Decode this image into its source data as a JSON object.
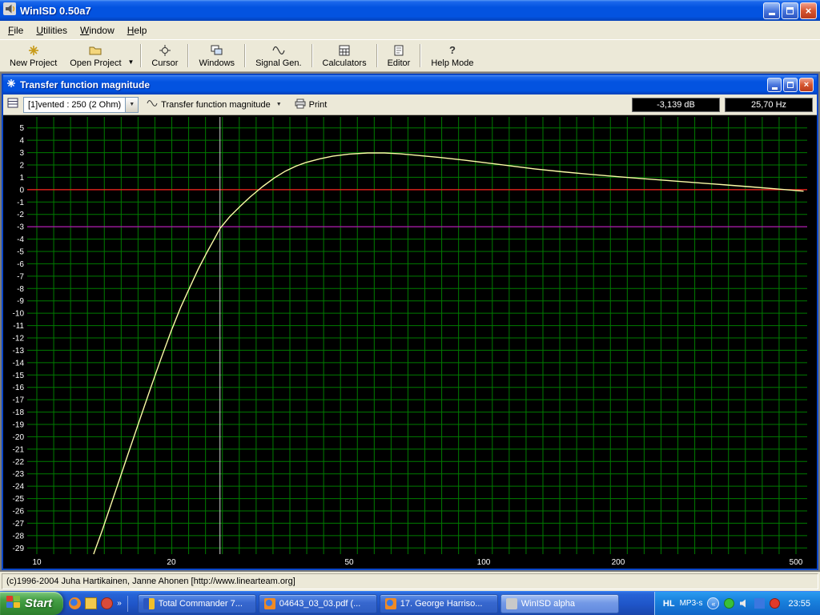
{
  "window": {
    "title": "WinISD 0.50a7",
    "menu": [
      {
        "label": "File"
      },
      {
        "label": "Utilities"
      },
      {
        "label": "Window"
      },
      {
        "label": "Help"
      }
    ]
  },
  "toolbar": {
    "buttons": [
      {
        "label": "New Project",
        "icon": "new-project-icon"
      },
      {
        "label": "Open Project",
        "icon": "open-project-icon"
      },
      {
        "label": "Cursor",
        "icon": "cursor-icon"
      },
      {
        "label": "Windows",
        "icon": "windows-icon"
      },
      {
        "label": "Signal Gen.",
        "icon": "signal-gen-icon"
      },
      {
        "label": "Calculators",
        "icon": "calculators-icon"
      },
      {
        "label": "Editor",
        "icon": "editor-icon"
      },
      {
        "label": "Help Mode",
        "icon": "help-mode-icon"
      }
    ]
  },
  "plot_window": {
    "title": "Transfer function magnitude",
    "project_selector": "[1]vented : 250 (2 Ohm)",
    "graph_selector": "Transfer function magnitude",
    "print_label": "Print"
  },
  "statusbar": {
    "text": "(c)1996-2004 Juha Hartikainen, Janne Ahonen [http://www.linearteam.org]"
  },
  "taskbar": {
    "start_label": "Start",
    "tasks": [
      {
        "label": "Total Commander 7...",
        "active": false,
        "icon": "total-commander-icon"
      },
      {
        "label": "04643_03_03.pdf (...",
        "active": false,
        "icon": "firefox-document-icon"
      },
      {
        "label": "17. George Harriso...",
        "active": false,
        "icon": "firefox-document-icon"
      },
      {
        "label": "WinISD alpha",
        "active": true,
        "icon": "winisd-icon"
      }
    ],
    "tray": {
      "lang": "HL",
      "item": "MP3-s",
      "clock": "23:55"
    }
  },
  "icons": {
    "dropdown": "▼",
    "double-left": "«",
    "double-right": "»",
    "question": "?",
    "close": "×"
  },
  "chart_data": {
    "type": "line",
    "title": "Transfer function magnitude",
    "x_axis": {
      "scale": "log",
      "unit": "Hz",
      "min": 10,
      "max": 500,
      "ticks": [
        10,
        20,
        50,
        100,
        200,
        500
      ]
    },
    "y_axis": {
      "unit": "dB",
      "min": -29,
      "max": 5,
      "step": 1,
      "ticks": [
        5,
        4,
        3,
        2,
        1,
        0,
        -1,
        -2,
        -3,
        -4,
        -5,
        -6,
        -7,
        -8,
        -9,
        -10,
        -11,
        -12,
        -13,
        -14,
        -15,
        -16,
        -17,
        -18,
        -19,
        -20,
        -21,
        -22,
        -23,
        -24,
        -25,
        -26,
        -27,
        -28,
        -29
      ]
    },
    "grid": {
      "color": "#007C00",
      "vertical_divisions": 45,
      "background": "#000000",
      "label_color": "#FFFFFF"
    },
    "reference_lines": [
      {
        "value": 0,
        "color": "#FF2020",
        "name": "zero-db-reference"
      },
      {
        "value": -3,
        "color": "#B318B3",
        "name": "minus-3db-reference"
      }
    ],
    "cursor": {
      "frequency_hz": 25.7,
      "color": "#D8D8D8",
      "readout_db": "-3,139 dB",
      "readout_hz": "25,70 Hz"
    },
    "series": [
      {
        "name": "[1]vented : 250 (2 Ohm)",
        "color": "#FBFBA6",
        "points": [
          [
            13.4,
            -29.5
          ],
          [
            14,
            -27.6
          ],
          [
            15,
            -24.4
          ],
          [
            16,
            -21.4
          ],
          [
            17,
            -18.6
          ],
          [
            18,
            -16.0
          ],
          [
            19,
            -13.6
          ],
          [
            20,
            -11.4
          ],
          [
            21,
            -9.5
          ],
          [
            22,
            -7.9
          ],
          [
            23,
            -6.4
          ],
          [
            24,
            -5.1
          ],
          [
            25,
            -3.95
          ],
          [
            25.7,
            -3.139
          ],
          [
            27,
            -2.2
          ],
          [
            28.5,
            -1.35
          ],
          [
            30,
            -0.6
          ],
          [
            32,
            0.25
          ],
          [
            34,
            0.95
          ],
          [
            36,
            1.5
          ],
          [
            38,
            1.9
          ],
          [
            40,
            2.2
          ],
          [
            43,
            2.5
          ],
          [
            46,
            2.72
          ],
          [
            50,
            2.88
          ],
          [
            55,
            2.97
          ],
          [
            60,
            2.97
          ],
          [
            65,
            2.9
          ],
          [
            70,
            2.8
          ],
          [
            80,
            2.6
          ],
          [
            90,
            2.4
          ],
          [
            100,
            2.2
          ],
          [
            115,
            1.92
          ],
          [
            130,
            1.68
          ],
          [
            150,
            1.45
          ],
          [
            170,
            1.27
          ],
          [
            200,
            1.05
          ],
          [
            230,
            0.88
          ],
          [
            260,
            0.73
          ],
          [
            300,
            0.56
          ],
          [
            350,
            0.38
          ],
          [
            400,
            0.22
          ],
          [
            450,
            0.07
          ],
          [
            500,
            -0.07
          ],
          [
            520,
            -0.12
          ]
        ]
      }
    ]
  }
}
